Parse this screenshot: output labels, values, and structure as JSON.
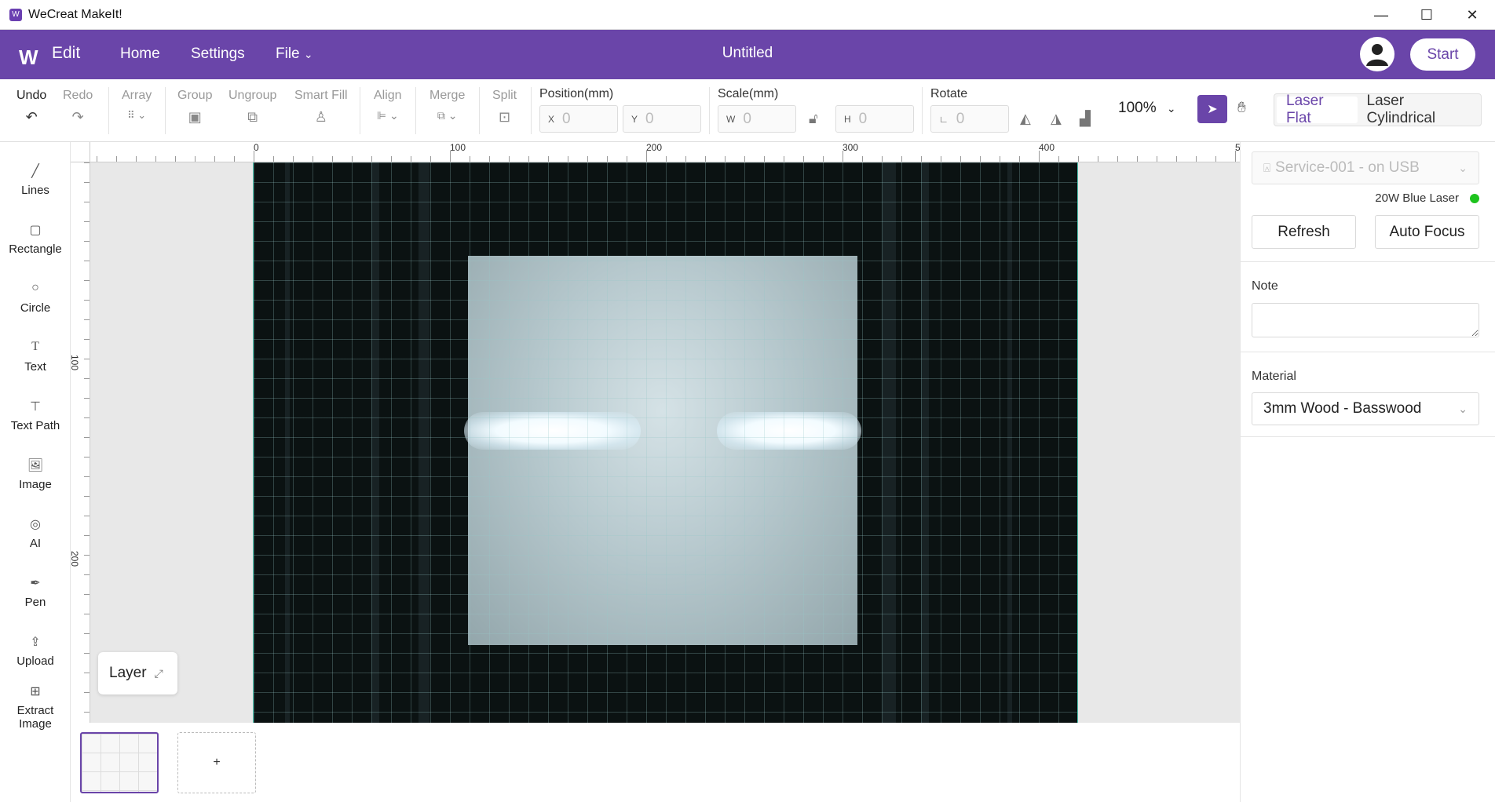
{
  "window": {
    "title": "WeCreat MakeIt!",
    "controls": [
      "—",
      "☐",
      "✕"
    ]
  },
  "header": {
    "section": "Edit",
    "nav": [
      "Home",
      "Settings",
      "File"
    ],
    "file_chevron": "⌄",
    "doc_title": "Untitled",
    "start_label": "Start"
  },
  "toolbar": {
    "undo": "Undo",
    "redo": "Redo",
    "array": "Array",
    "group": "Group",
    "ungroup": "Ungroup",
    "smart_fill": "Smart Fill",
    "align": "Align",
    "merge": "Merge",
    "split": "Split",
    "position_label": "Position(mm)",
    "pos_x_prefix": "X",
    "pos_x": "0",
    "pos_y_prefix": "Y",
    "pos_y": "0",
    "scale_label": "Scale(mm)",
    "scale_w_prefix": "W",
    "scale_w": "0",
    "scale_h_prefix": "H",
    "scale_h": "0",
    "rotate_label": "Rotate",
    "rotate_value": "0",
    "zoom": "100%",
    "modes": [
      "Laser Flat",
      "Laser Cylindrical"
    ],
    "active_mode": "Laser Flat"
  },
  "left_tools": [
    "Lines",
    "Rectangle",
    "Circle",
    "Text",
    "Text Path",
    "Image",
    "AI",
    "Pen",
    "Upload"
  ],
  "extract_tool": [
    "Extract",
    "Image"
  ],
  "ruler": {
    "top": [
      "0",
      "100",
      "200",
      "300",
      "400",
      "5"
    ],
    "left": [
      "100",
      "200"
    ]
  },
  "layer_label": "Layer",
  "add_page_label": "+",
  "right_panel": {
    "device": "Service-001 - on USB",
    "laser": "20W Blue Laser",
    "status_color": "#1ec31e",
    "refresh": "Refresh",
    "auto_focus": "Auto Focus",
    "note_label": "Note",
    "note_value": "",
    "material_label": "Material",
    "material_value": "3mm Wood - Basswood"
  },
  "colors": {
    "brand": "#6a45a9",
    "canvas_border": "#4fc4b0"
  }
}
